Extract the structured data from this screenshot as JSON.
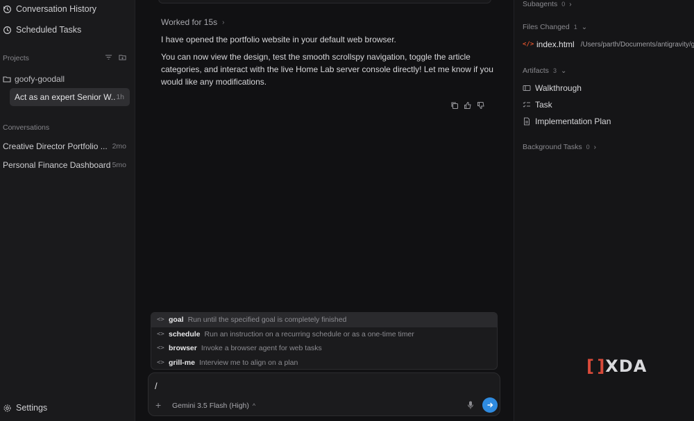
{
  "sidebar": {
    "nav": [
      {
        "label": "Conversation History",
        "icon": "history-icon"
      },
      {
        "label": "Scheduled Tasks",
        "icon": "clock-icon"
      }
    ],
    "projects_title": "Projects",
    "project_name": "goofy-goodall",
    "active_chat": {
      "title": "Act as an expert Senior W...",
      "time": "1h"
    },
    "conversations_title": "Conversations",
    "conversations": [
      {
        "title": "Creative Director Portfolio ...",
        "time": "2mo"
      },
      {
        "title": "Personal Finance Dashboard",
        "time": "5mo"
      }
    ],
    "settings_label": "Settings"
  },
  "main": {
    "worked_label": "Worked for 15s",
    "messages": [
      "I have opened the portfolio website in your default web browser.",
      "You can now view the design, test the smooth scrollspy navigation, toggle the article categories, and interact with the live Home Lab server console directly! Let me know if you would like any modifications."
    ],
    "commands": [
      {
        "name": "goal",
        "desc": "Run until the specified goal is completely finished"
      },
      {
        "name": "schedule",
        "desc": "Run an instruction on a recurring schedule or as a one-time timer"
      },
      {
        "name": "browser",
        "desc": "Invoke a browser agent for web tasks"
      },
      {
        "name": "grill-me",
        "desc": "Interview me to align on a plan"
      }
    ],
    "composer_text": "/",
    "model_label": "Gemini 3.5 Flash (High)"
  },
  "right": {
    "subagents": {
      "label": "Subagents",
      "count": "0"
    },
    "files_changed": {
      "label": "Files Changed",
      "count": "1"
    },
    "file": {
      "name": "index.html",
      "path": "/Users/parth/Documents/antigravity/g"
    },
    "artifacts": {
      "label": "Artifacts",
      "count": "3"
    },
    "artifact_items": [
      "Walkthrough",
      "Task",
      "Implementation Plan"
    ],
    "background_tasks": {
      "label": "Background Tasks",
      "count": "0"
    }
  },
  "watermark": "XDA",
  "colors": {
    "accent": "#2f8be0",
    "code_icon": "#e2552e",
    "xda_red": "#d84a3a"
  }
}
